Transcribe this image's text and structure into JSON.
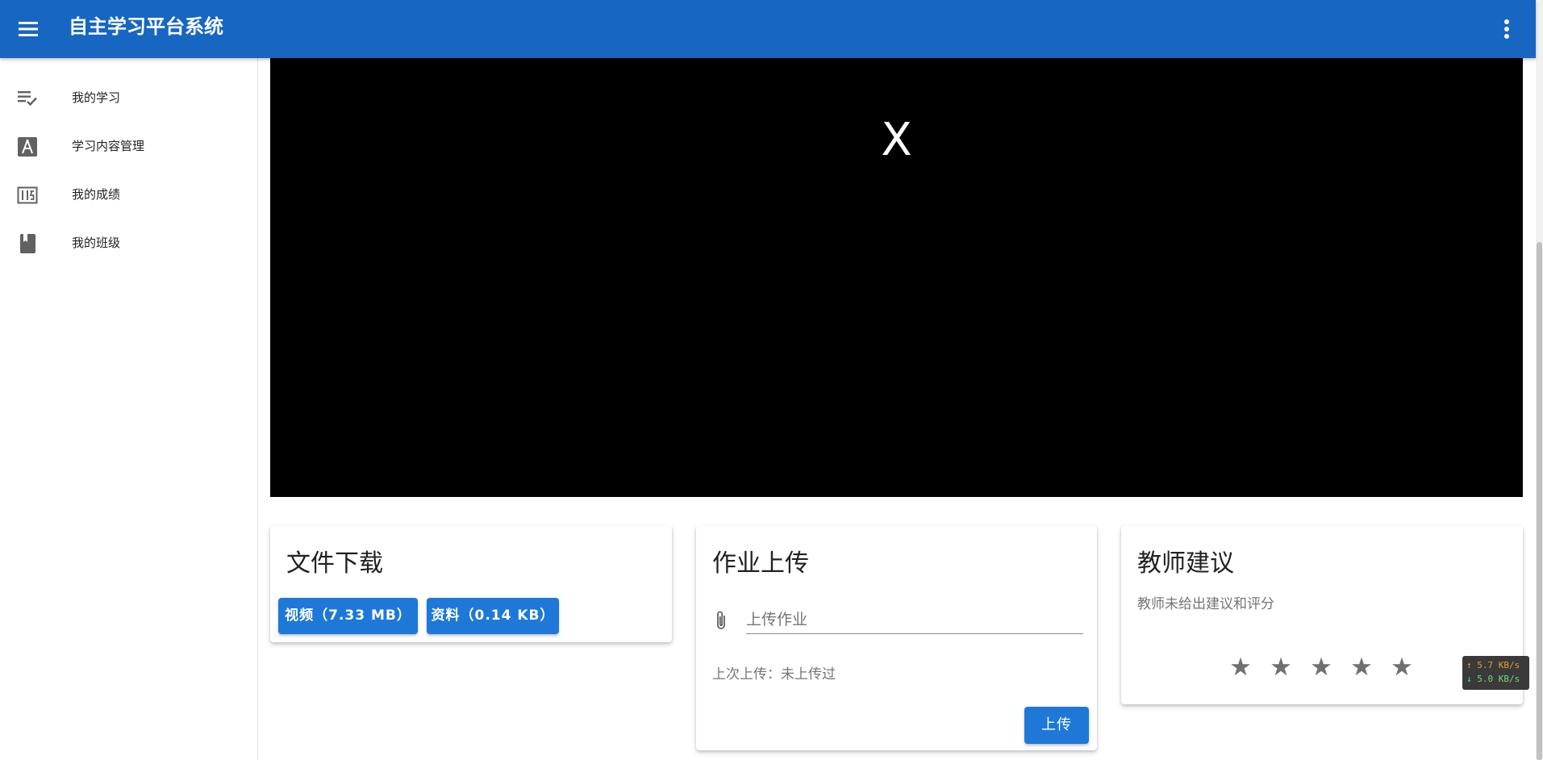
{
  "app": {
    "title": "自主学习平台系统"
  },
  "sidebar": {
    "items": [
      {
        "label": "我的学习",
        "icon": "playlist-check-icon"
      },
      {
        "label": "学习内容管理",
        "icon": "compass-icon"
      },
      {
        "label": "我的成绩",
        "icon": "grade-icon"
      },
      {
        "label": "我的班级",
        "icon": "book-icon"
      }
    ]
  },
  "video": {
    "error_mark": "X"
  },
  "download_card": {
    "title": "文件下载",
    "video_button": "视频（7.33 MB）",
    "material_button": "资料（0.14 KB）"
  },
  "homework_card": {
    "title": "作业上传",
    "upload_placeholder": "上传作业",
    "last_upload": "上次上传：未上传过",
    "upload_button": "上传"
  },
  "teacher_card": {
    "title": "教师建议",
    "note": "教师未给出建议和评分",
    "stars": [
      "★",
      "★",
      "★",
      "★",
      "★"
    ],
    "rating": 0
  },
  "network": {
    "up": "↑ 5.7 KB/s",
    "down": "↓ 5.0 KB/s"
  },
  "colors": {
    "primary": "#1766c2",
    "button": "#1e78d8"
  }
}
